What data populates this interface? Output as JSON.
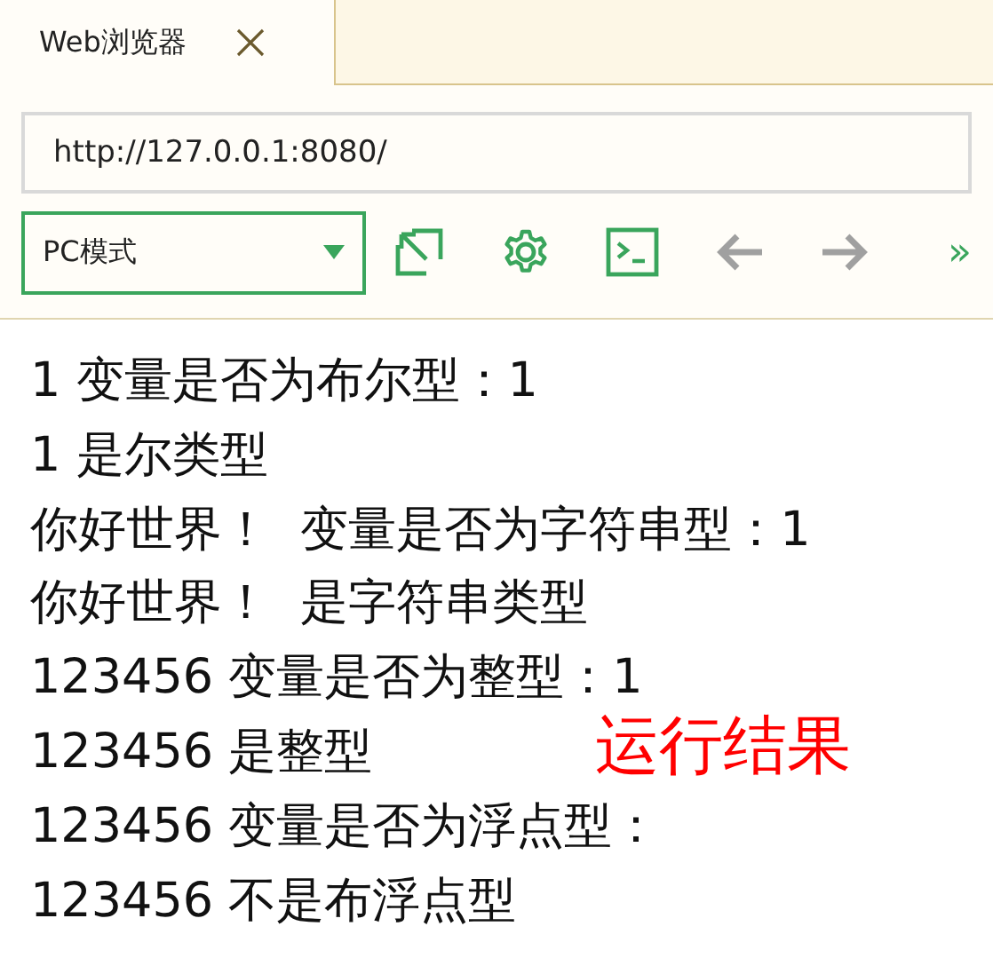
{
  "tabs": [
    {
      "label": "Web浏览器",
      "selected": true
    }
  ],
  "address_bar": {
    "value": "http://127.0.0.1:8080/"
  },
  "toolbar": {
    "mode_select": "PC模式",
    "more": "»"
  },
  "output_lines": [
    "1 变量是否为布尔型：1",
    "1 是尔类型",
    "你好世界！  变量是否为字符串型：1",
    "你好世界！  是字符串类型",
    "123456 变量是否为整型：1",
    "123456 是整型",
    "123456 变量是否为浮点型：",
    "123456 不是布浮点型"
  ],
  "annotation": "运行结果"
}
